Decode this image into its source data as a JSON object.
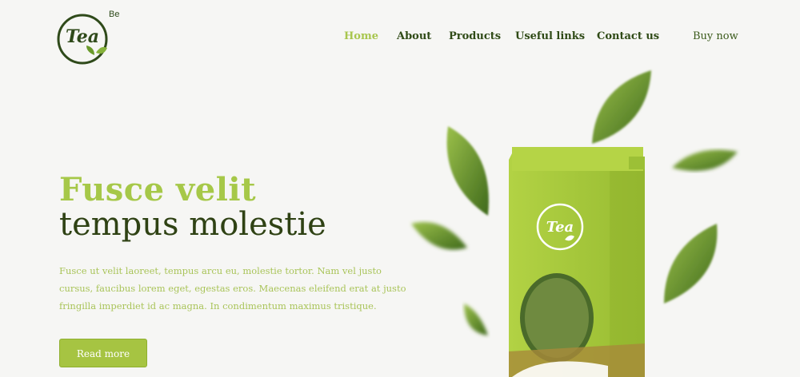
{
  "brand": {
    "logo_text": "Tea",
    "superscript": "Be"
  },
  "nav": {
    "items": [
      {
        "label": "Home",
        "active": true
      },
      {
        "label": "About",
        "active": false
      },
      {
        "label": "Products",
        "active": false
      },
      {
        "label": "Useful links",
        "active": false
      },
      {
        "label": "Contact us",
        "active": false
      }
    ],
    "buy_now": "Buy now"
  },
  "hero": {
    "title_line1": "Fusce velit",
    "title_line2": "tempus molestie",
    "description": "Fusce ut velit laoreet, tempus arcu eu, molestie tortor. Nam vel justo cursus, faucibus lorem eget, egestas eros. Maecenas eleifend erat at justo fringilla imperdiet id ac magna. In condimentum maximus tristique.",
    "cta_label": "Read more",
    "package_logo_text": "Tea"
  },
  "colors": {
    "accent_green": "#a6c848",
    "dark_green": "#2f4214",
    "background": "#f6f6f4"
  }
}
